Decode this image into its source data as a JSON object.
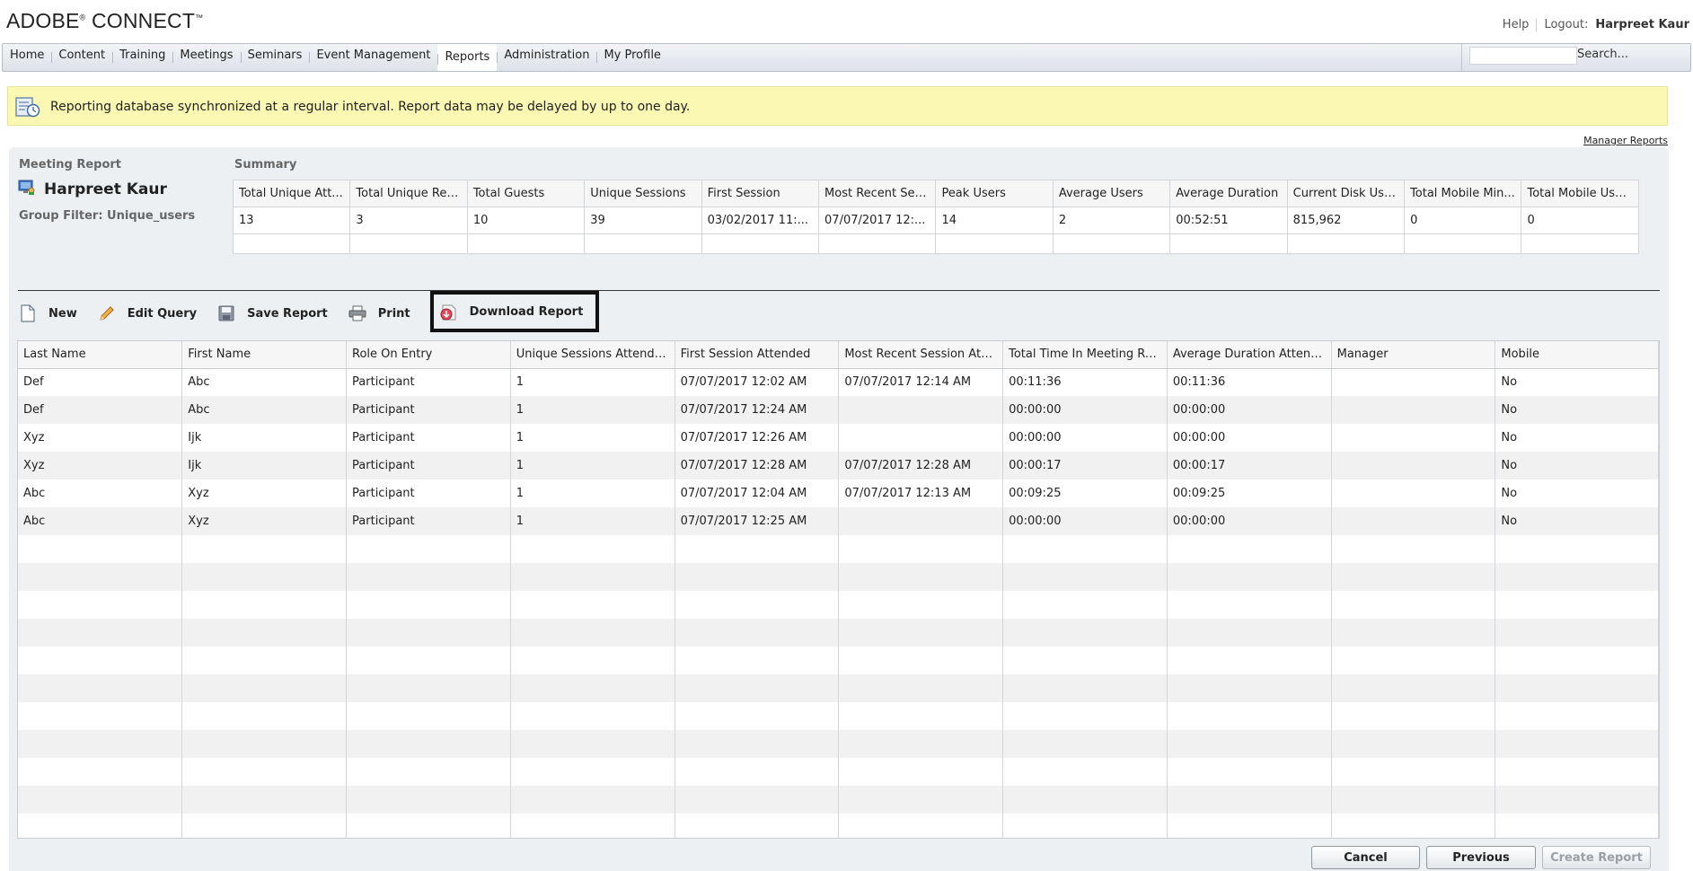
{
  "header": {
    "logo": "ADOBE",
    "logo_mark": "®",
    "logo_product": " CONNECT",
    "logo_tm": "™",
    "help": "Help",
    "logout_label": "Logout:",
    "user": "Harpreet Kaur"
  },
  "nav": {
    "items": [
      "Home",
      "Content",
      "Training",
      "Meetings",
      "Seminars",
      "Event Management",
      "Reports",
      "Administration",
      "My Profile"
    ],
    "active": "Reports",
    "search_placeholder": "",
    "search_button": "Search..."
  },
  "notice": {
    "text": "Reporting database synchronized at a regular interval. Report data may be delayed by up to one day."
  },
  "manager_reports_link": "Manager Reports",
  "report": {
    "type_label": "Meeting Report",
    "owner": "Harpreet Kaur",
    "group_filter": "Group Filter: Unique_users",
    "summary_label": "Summary"
  },
  "summary": {
    "headers": [
      "Total Unique Att...",
      "Total Unique Reg...",
      "Total Guests",
      "Unique Sessions",
      "First Session",
      "Most Recent Ses...",
      "Peak Users",
      "Average Users",
      "Average Duration",
      "Current Disk Usa...",
      "Total Mobile Min...",
      "Total Mobile Users"
    ],
    "values": [
      "13",
      "3",
      "10",
      "39",
      "03/02/2017 11:...",
      "07/07/2017 12:...",
      "14",
      "2",
      "00:52:51",
      "815,962",
      "0",
      "0"
    ]
  },
  "toolbar": {
    "new": "New",
    "edit_query": "Edit Query",
    "save_report": "Save Report",
    "print": "Print",
    "download_report": "Download Report"
  },
  "grid": {
    "headers": [
      "Last Name",
      "First Name",
      "Role On Entry",
      "Unique Sessions Attended",
      "First Session Attended",
      "Most Recent Session Atte...",
      "Total Time In Meeting Ro...",
      "Average Duration Attend...",
      "Manager",
      "Mobile"
    ],
    "rows": [
      [
        "Def",
        "Abc",
        "Participant",
        "1",
        "07/07/2017 12:02 AM",
        "07/07/2017 12:14 AM",
        "00:11:36",
        "00:11:36",
        "",
        "No"
      ],
      [
        "Def",
        "Abc",
        "Participant",
        "1",
        "07/07/2017 12:24 AM",
        "",
        "00:00:00",
        "00:00:00",
        "",
        "No"
      ],
      [
        "Xyz",
        "Ijk",
        "Participant",
        "1",
        "07/07/2017 12:26 AM",
        "",
        "00:00:00",
        "00:00:00",
        "",
        "No"
      ],
      [
        "Xyz",
        "Ijk",
        "Participant",
        "1",
        "07/07/2017 12:28 AM",
        "07/07/2017 12:28 AM",
        "00:00:17",
        "00:00:17",
        "",
        "No"
      ],
      [
        "Abc",
        "Xyz",
        "Participant",
        "1",
        "07/07/2017 12:04 AM",
        "07/07/2017 12:13 AM",
        "00:09:25",
        "00:09:25",
        "",
        "No"
      ],
      [
        "Abc",
        "Xyz",
        "Participant",
        "1",
        "07/07/2017 12:25 AM",
        "",
        "00:00:00",
        "00:00:00",
        "",
        "No"
      ]
    ]
  },
  "buttons": {
    "cancel": "Cancel",
    "previous": "Previous",
    "create_report": "Create Report"
  }
}
